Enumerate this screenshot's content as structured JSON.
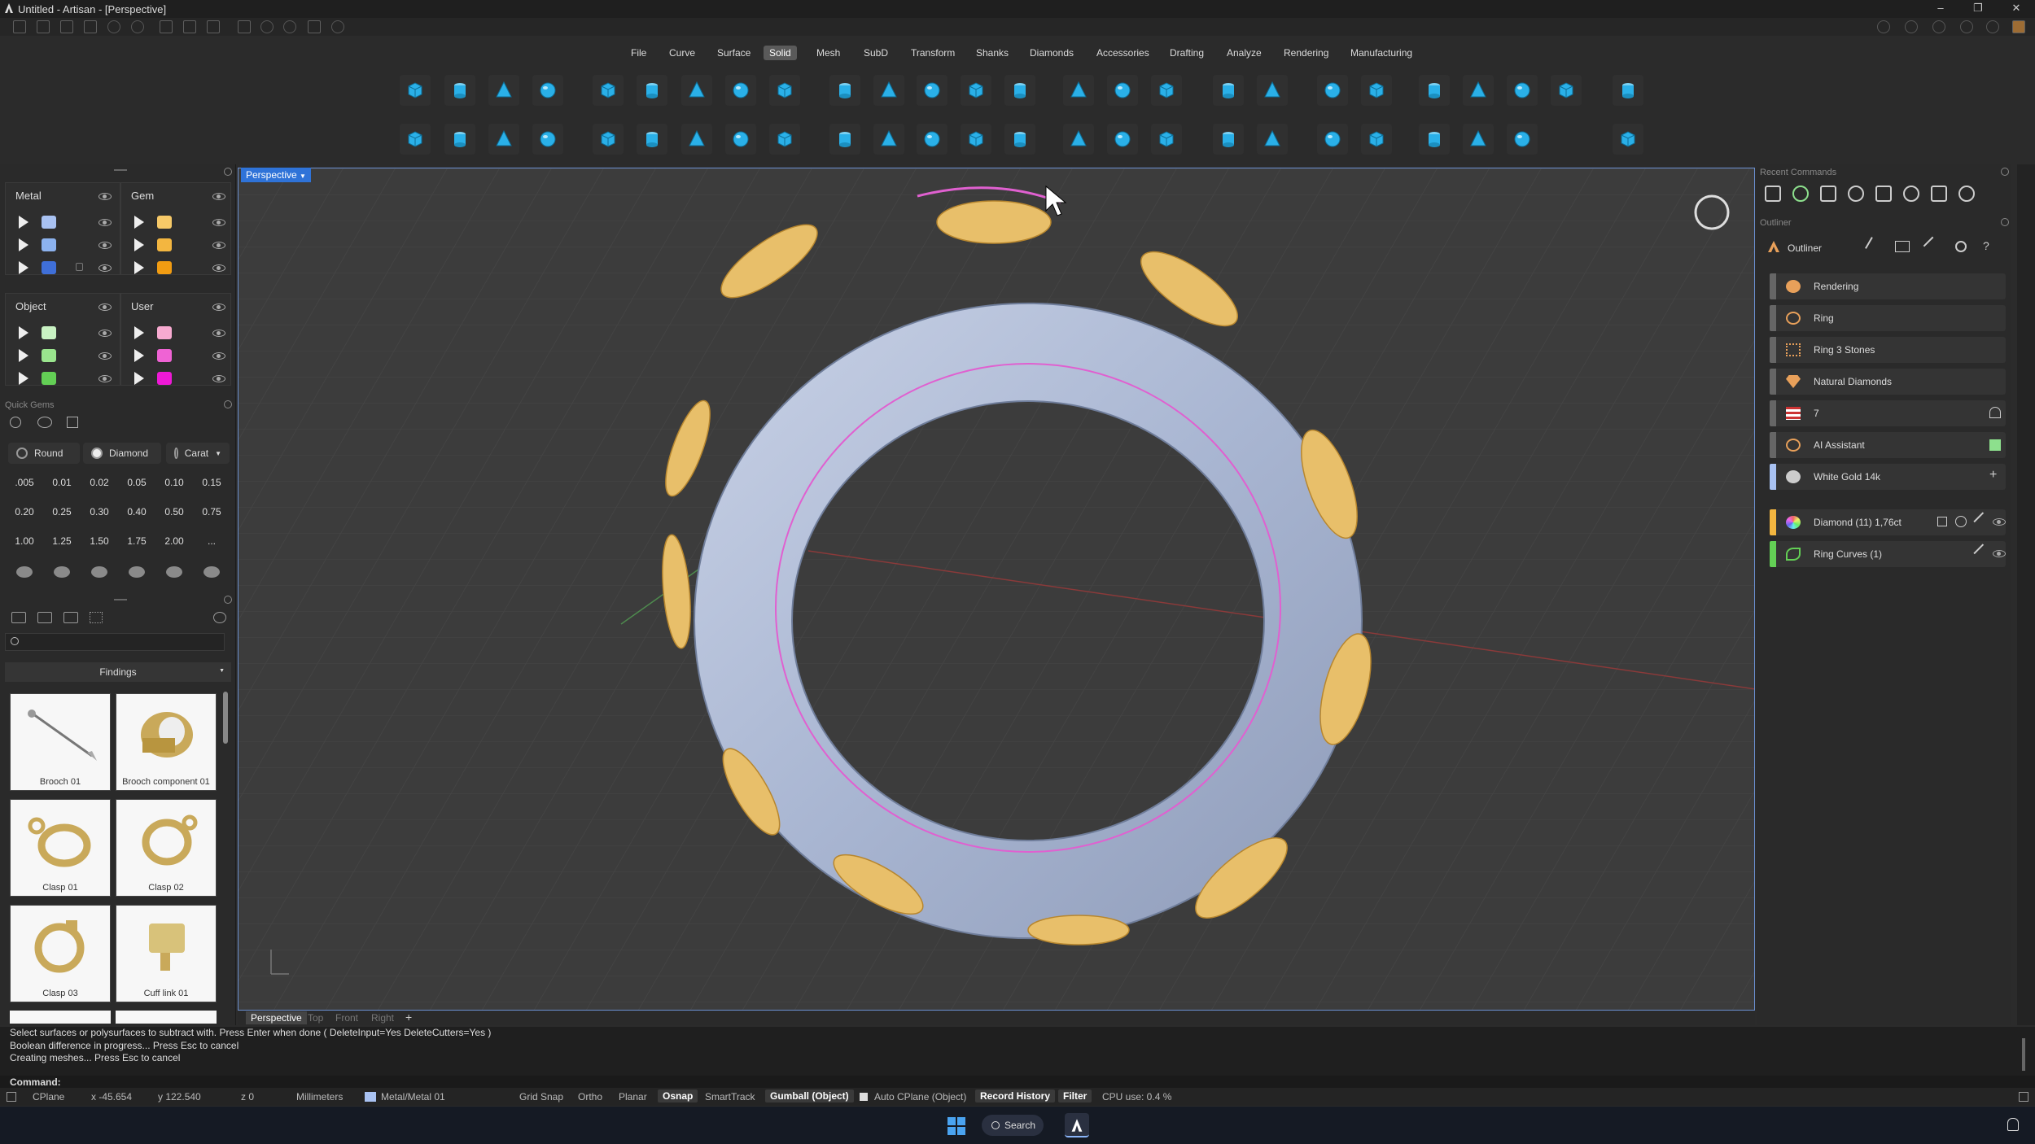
{
  "window": {
    "title": "Untitled - Artisan - [Perspective]"
  },
  "menu": [
    "File",
    "Curve",
    "Surface",
    "Solid",
    "Mesh",
    "SubD",
    "Transform",
    "Shanks",
    "Diamonds",
    "Accessories",
    "Drafting",
    "Analyze",
    "Rendering",
    "Manufacturing"
  ],
  "active_menu": "Solid",
  "layers": {
    "metal": {
      "title": "Metal",
      "colors": [
        "#a9c2f2",
        "#8cb2ee",
        "#3f6fd8"
      ]
    },
    "gem": {
      "title": "Gem",
      "colors": [
        "#f6c968",
        "#f3b640",
        "#f19c12"
      ]
    },
    "object": {
      "title": "Object",
      "colors": [
        "#c9f2c3",
        "#9ae58e",
        "#63cf55"
      ]
    },
    "user": {
      "title": "User",
      "colors": [
        "#f7aad0",
        "#ef63d4",
        "#ee19d6"
      ]
    }
  },
  "quick_gems": {
    "title": "Quick Gems",
    "cut": "Round",
    "material": "Diamond",
    "unit": "Carat",
    "sizes": [
      ".005",
      "0.01",
      "0.02",
      "0.05",
      "0.10",
      "0.15",
      "0.20",
      "0.25",
      "0.30",
      "0.40",
      "0.50",
      "0.75",
      "1.00",
      "1.25",
      "1.50",
      "1.75",
      "2.00",
      "..."
    ]
  },
  "library": {
    "category": "Findings",
    "items": [
      "Brooch 01",
      "Brooch component 01",
      "Clasp 01",
      "Clasp 02",
      "Clasp 03",
      "Cuff link 01"
    ]
  },
  "viewport": {
    "name": "Perspective",
    "tabs": [
      "Perspective",
      "Top",
      "Front",
      "Right",
      "+"
    ]
  },
  "right_panel": {
    "recent_commands": "Recent Commands",
    "outliner_section": "Outliner",
    "outliner_title": "Outliner",
    "items": [
      "Rendering",
      "Ring",
      "Ring 3 Stones",
      "Natural Diamonds",
      "7",
      "AI Assistant",
      "White Gold 14k"
    ],
    "objects": [
      "Diamond (11) 1,76ct",
      "Ring Curves (1)"
    ]
  },
  "command": {
    "history": [
      "Select surfaces or polysurfaces to subtract with. Press Enter when done ( DeleteInput=Yes  DeleteCutters=Yes )",
      "Boolean difference in progress... Press Esc to cancel",
      "Creating meshes... Press Esc to cancel"
    ],
    "prompt": "Command:"
  },
  "status": {
    "cplane": "CPlane",
    "x": "x -45.654",
    "y": "y 122.540",
    "z": "z 0",
    "units": "Millimeters",
    "layer": "Metal/Metal 01",
    "toggles": [
      "Grid Snap",
      "Ortho",
      "Planar",
      "Osnap",
      "SmartTrack",
      "Gumball (Object)",
      "Auto CPlane (Object)",
      "Record History",
      "Filter"
    ],
    "cpu": "CPU use: 0.4 %"
  },
  "taskbar": {
    "search": "Search"
  },
  "colors": {
    "accent": "#2f73d8",
    "gem_gold": "#e8bf6a",
    "metal": "#b8c4dc"
  }
}
